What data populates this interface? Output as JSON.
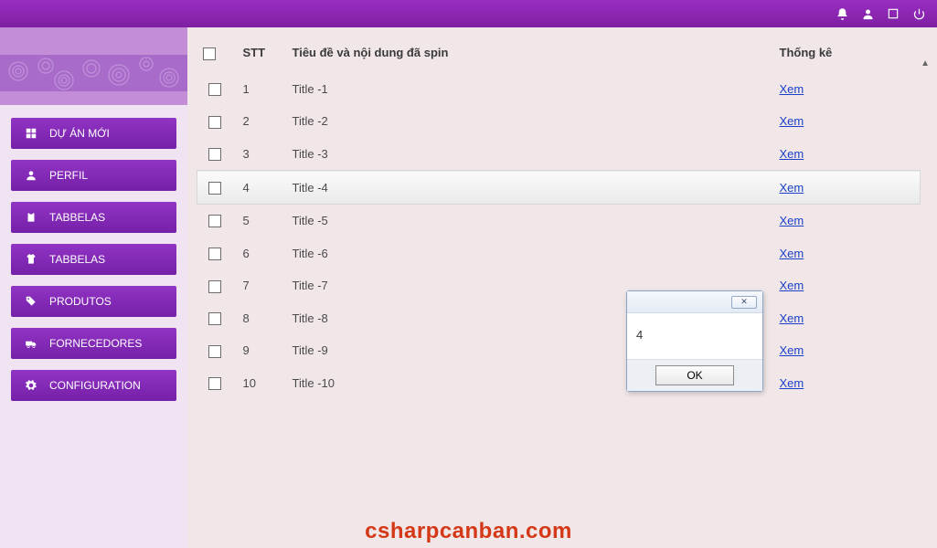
{
  "topbar": {
    "icons": [
      "bell",
      "user",
      "window",
      "power"
    ]
  },
  "sidebar": {
    "items": [
      {
        "icon": "grid",
        "label": "DỰ ÁN MỚI"
      },
      {
        "icon": "person",
        "label": "PERFIL"
      },
      {
        "icon": "clipboard",
        "label": "TABBELAS"
      },
      {
        "icon": "shirt",
        "label": "TABBELAS"
      },
      {
        "icon": "tags",
        "label": "PRODUTOS"
      },
      {
        "icon": "truck",
        "label": "FORNECEDORES"
      },
      {
        "icon": "gear",
        "label": "CONFIGURATION"
      }
    ]
  },
  "table": {
    "headers": {
      "stt": "STT",
      "title": "Tiêu đề và nội dung đã spin",
      "stats": "Thống kê"
    },
    "rows": [
      {
        "stt": "1",
        "title": "Title -1",
        "stats": "Xem",
        "selected": false
      },
      {
        "stt": "2",
        "title": "Title -2",
        "stats": "Xem",
        "selected": false
      },
      {
        "stt": "3",
        "title": "Title -3",
        "stats": "Xem",
        "selected": false
      },
      {
        "stt": "4",
        "title": "Title -4",
        "stats": "Xem",
        "selected": true
      },
      {
        "stt": "5",
        "title": "Title -5",
        "stats": "Xem",
        "selected": false
      },
      {
        "stt": "6",
        "title": "Title -6",
        "stats": "Xem",
        "selected": false
      },
      {
        "stt": "7",
        "title": "Title -7",
        "stats": "Xem",
        "selected": false
      },
      {
        "stt": "8",
        "title": "Title -8",
        "stats": "Xem",
        "selected": false
      },
      {
        "stt": "9",
        "title": "Title -9",
        "stats": "Xem",
        "selected": false
      },
      {
        "stt": "10",
        "title": "Title -10",
        "stats": "Xem",
        "selected": false
      }
    ]
  },
  "dialog": {
    "message": "4",
    "ok_label": "OK"
  },
  "watermark": "csharpcanban.com"
}
